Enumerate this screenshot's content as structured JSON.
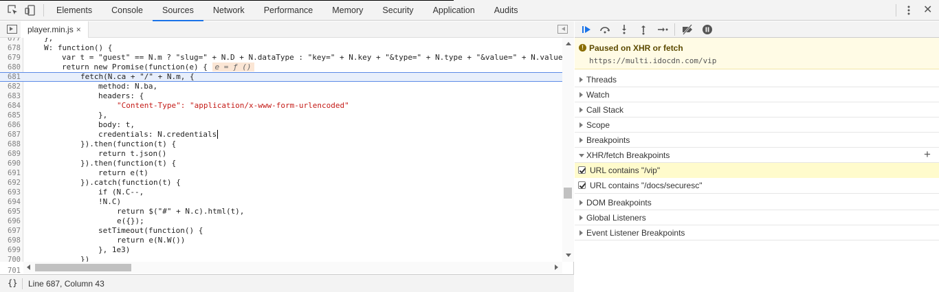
{
  "toolbar": {
    "tabs": [
      "Elements",
      "Console",
      "Sources",
      "Network",
      "Performance",
      "Memory",
      "Security",
      "Application",
      "Audits"
    ],
    "active_tab": "Sources"
  },
  "editor": {
    "file_tab": "player.min.js",
    "file_tab_close": "×",
    "lines": [
      {
        "n": "677",
        "t": "},"
      },
      {
        "n": "678",
        "t": "W: function() {"
      },
      {
        "n": "679",
        "t": "var t = \"guest\" == N.m ? \"slug=\" + N.D + N.dataType : \"key=\" + N.key + \"&type=\" + N.type + \"&value=\" + N.value"
      },
      {
        "n": "680",
        "t": "return new Promise(function(e) {",
        "inline": "e = ƒ ()"
      },
      {
        "n": "681",
        "t": "fetch(N.ca + \"/\" + N.m, {"
      },
      {
        "n": "682",
        "t": "method: N.ba,"
      },
      {
        "n": "683",
        "t": "headers: {"
      },
      {
        "n": "684",
        "t": "\"Content-Type\": \"application/x-www-form-urlencoded\""
      },
      {
        "n": "685",
        "t": "},"
      },
      {
        "n": "686",
        "t": "body: t,"
      },
      {
        "n": "687",
        "t": "credentials: N.credentials"
      },
      {
        "n": "688",
        "t": "}).then(function(t) {"
      },
      {
        "n": "689",
        "t": "return t.json()"
      },
      {
        "n": "690",
        "t": "}).then(function(t) {"
      },
      {
        "n": "691",
        "t": "return e(t)"
      },
      {
        "n": "692",
        "t": "}).catch(function(t) {"
      },
      {
        "n": "693",
        "t": "if (N.C--,"
      },
      {
        "n": "694",
        "t": "!N.C)"
      },
      {
        "n": "695",
        "t": "return $(\"#\" + N.c).html(t),"
      },
      {
        "n": "696",
        "t": "e({});"
      },
      {
        "n": "697",
        "t": "setTimeout(function() {"
      },
      {
        "n": "698",
        "t": "return e(N.W())"
      },
      {
        "n": "699",
        "t": "}, 1e3)"
      },
      {
        "n": "700",
        "t": "})"
      },
      {
        "n": "701",
        "t": ""
      }
    ]
  },
  "status": {
    "braces": "{}",
    "position": "Line 687, Column 43"
  },
  "debugger": {
    "paused_title": "Paused on XHR or fetch",
    "paused_url": "https://multi.idocdn.com/vip",
    "sections_top": [
      "Threads",
      "Watch",
      "Call Stack",
      "Scope",
      "Breakpoints"
    ],
    "xhr_section": "XHR/fetch Breakpoints",
    "xhr_breakpoints": [
      "URL contains \"/vip\"",
      "URL contains \"/docs/securesc\""
    ],
    "sections_bottom": [
      "DOM Breakpoints",
      "Global Listeners",
      "Event Listener Breakpoints"
    ]
  },
  "colors": {
    "accent": "#1a73e8",
    "paused_bg": "#fffbe5",
    "highlight_bg": "#fffbcc"
  }
}
